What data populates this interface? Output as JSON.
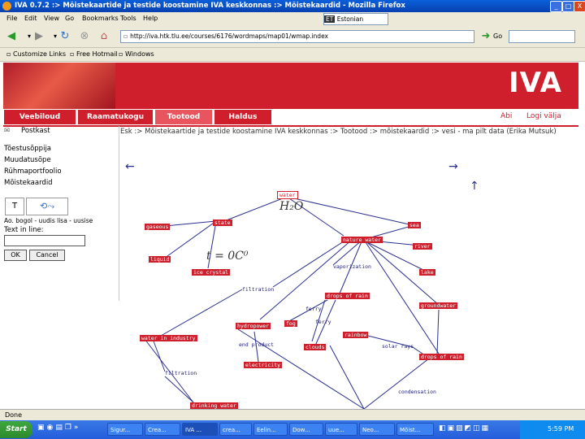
{
  "window": {
    "title": "IVA 0.7.2 :> Mõistekaartide ja testide koostamine IVA keskkonnas :> Mõistekaardid - Mozilla Firefox",
    "controls": [
      "_",
      "□",
      "X"
    ]
  },
  "menubar": [
    "File",
    "Edit",
    "View",
    "Go",
    "Bookmarks",
    "Tools",
    "Help"
  ],
  "toolbar": {
    "url": "http://iva.htk.tlu.ee/courses/6176/wordmaps/map01/wmap.index",
    "go_label": "Go",
    "search_engine": "Estonian"
  },
  "bookmarks": [
    "Customize Links",
    "Free Hotmail",
    "Windows"
  ],
  "site": {
    "logo": "IVA",
    "tabs": [
      "Veebiloud",
      "Raamatukogu",
      "Tootood",
      "Haldus"
    ],
    "active_tab": 2,
    "top_links": [
      "Abi",
      "Logi välja"
    ]
  },
  "sidebar": {
    "items": [
      "Postkast",
      "Tõestusõppija",
      "Muudatusõpe",
      "Rühmaportfoolio",
      "Mõistekaardid"
    ],
    "editor_label": "Ao. bogol - uudis lisa - uusise",
    "text_label": "Text in line:",
    "ok_label": "OK",
    "cancel_label": "Cancel"
  },
  "breadcrumb": "Esk :> Mõistekaartide ja testide koostamine IVA keskkonnas :> Tootood :> mõistekaardid :> vesi - ma pilt data (Erika Mutsuk)",
  "map": {
    "nodes": [
      {
        "id": "water",
        "label": "water",
        "selected": true
      },
      {
        "id": "gaseous",
        "label": "gaseous"
      },
      {
        "id": "state",
        "label": "state"
      },
      {
        "id": "liquid",
        "label": "liquid"
      },
      {
        "id": "ice",
        "label": "ice crystal"
      },
      {
        "id": "sea",
        "label": "sea"
      },
      {
        "id": "nature",
        "label": "nature water"
      },
      {
        "id": "river",
        "label": "river"
      },
      {
        "id": "lake",
        "label": "lake"
      },
      {
        "id": "vapor",
        "label": "vaporization"
      },
      {
        "id": "filtration",
        "label": "filtration"
      },
      {
        "id": "drops",
        "label": "drops of rain"
      },
      {
        "id": "ground",
        "label": "groundwater"
      },
      {
        "id": "fog",
        "label": "fog"
      },
      {
        "id": "industry",
        "label": "water in industry"
      },
      {
        "id": "hydro",
        "label": "hydropower"
      },
      {
        "id": "electricity",
        "label": "electricity"
      },
      {
        "id": "clouds",
        "label": "clouds"
      },
      {
        "id": "rainbow",
        "label": "rainbow"
      },
      {
        "id": "dropsrain",
        "label": "drops of rain"
      },
      {
        "id": "filtration2",
        "label": "filtration"
      },
      {
        "id": "drinking",
        "label": "drinking water"
      }
    ],
    "edge_labels": [
      "ferry",
      "ferry",
      "end product",
      "solar rays",
      "condensation"
    ],
    "formula_h2o": "H₂O",
    "formula_t": "t = 0C⁰",
    "arrows": [
      "←",
      "→",
      "↑"
    ]
  },
  "status": "Done",
  "taskbar": {
    "start": "Start",
    "tasks": [
      "Sigur...",
      "Crea...",
      "IVA ...",
      "crea...",
      "Eelin...",
      "Dow...",
      "uue...",
      "Neo...",
      "Mõist..."
    ],
    "clock": "5:59 PM"
  }
}
